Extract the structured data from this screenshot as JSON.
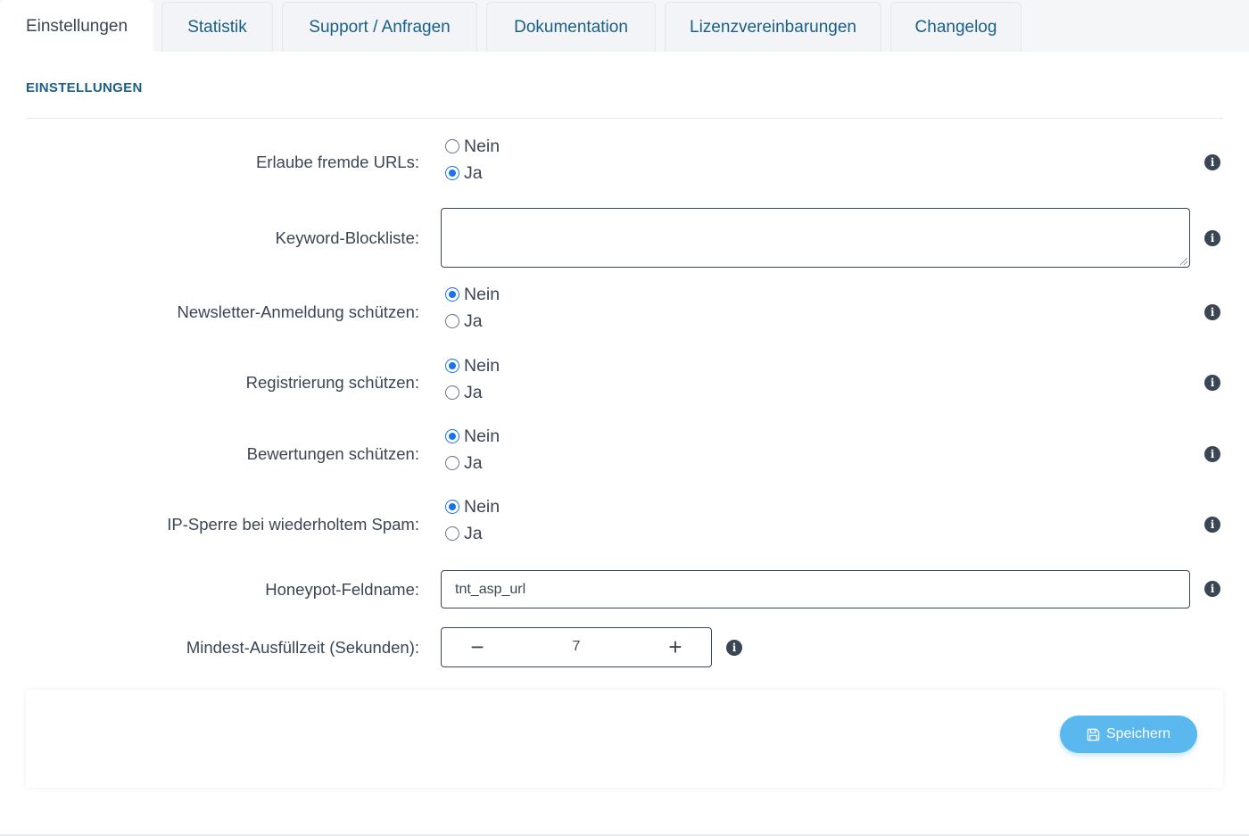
{
  "tabs": [
    {
      "label": "Einstellungen",
      "active": true
    },
    {
      "label": "Statistik"
    },
    {
      "label": "Support / Anfragen"
    },
    {
      "label": "Dokumentation"
    },
    {
      "label": "Lizenzvereinbarungen"
    },
    {
      "label": "Changelog"
    }
  ],
  "section_title": "EINSTELLUNGEN",
  "settings": {
    "foreign_urls": {
      "label": "Erlaube fremde URLs:",
      "options": [
        "Nein",
        "Ja"
      ],
      "selected": "Ja"
    },
    "keyword_blocklist": {
      "label": "Keyword-Blockliste:",
      "value": ""
    },
    "newsletter": {
      "label": "Newsletter-Anmeldung schützen:",
      "options": [
        "Nein",
        "Ja"
      ],
      "selected": "Nein"
    },
    "registration": {
      "label": "Registrierung schützen:",
      "options": [
        "Nein",
        "Ja"
      ],
      "selected": "Nein"
    },
    "reviews": {
      "label": "Bewertungen schützen:",
      "options": [
        "Nein",
        "Ja"
      ],
      "selected": "Nein"
    },
    "ip_block": {
      "label": "IP-Sperre bei wiederholtem Spam:",
      "options": [
        "Nein",
        "Ja"
      ],
      "selected": "Nein"
    },
    "honeypot": {
      "label": "Honeypot-Feldname:",
      "value": "tnt_asp_url"
    },
    "min_time": {
      "label": "Mindest-Ausfüllzeit (Sekunden):",
      "value": "7",
      "minus": "−",
      "plus": "+"
    }
  },
  "info_glyph": "i",
  "icons": {
    "info": "info-circle-icon",
    "save": "floppy-disk-icon"
  },
  "save_label": "Speichern",
  "colors": {
    "accent": "#1a5f87",
    "radio": "#1a73e8",
    "save_button": "#5bb8ef"
  }
}
